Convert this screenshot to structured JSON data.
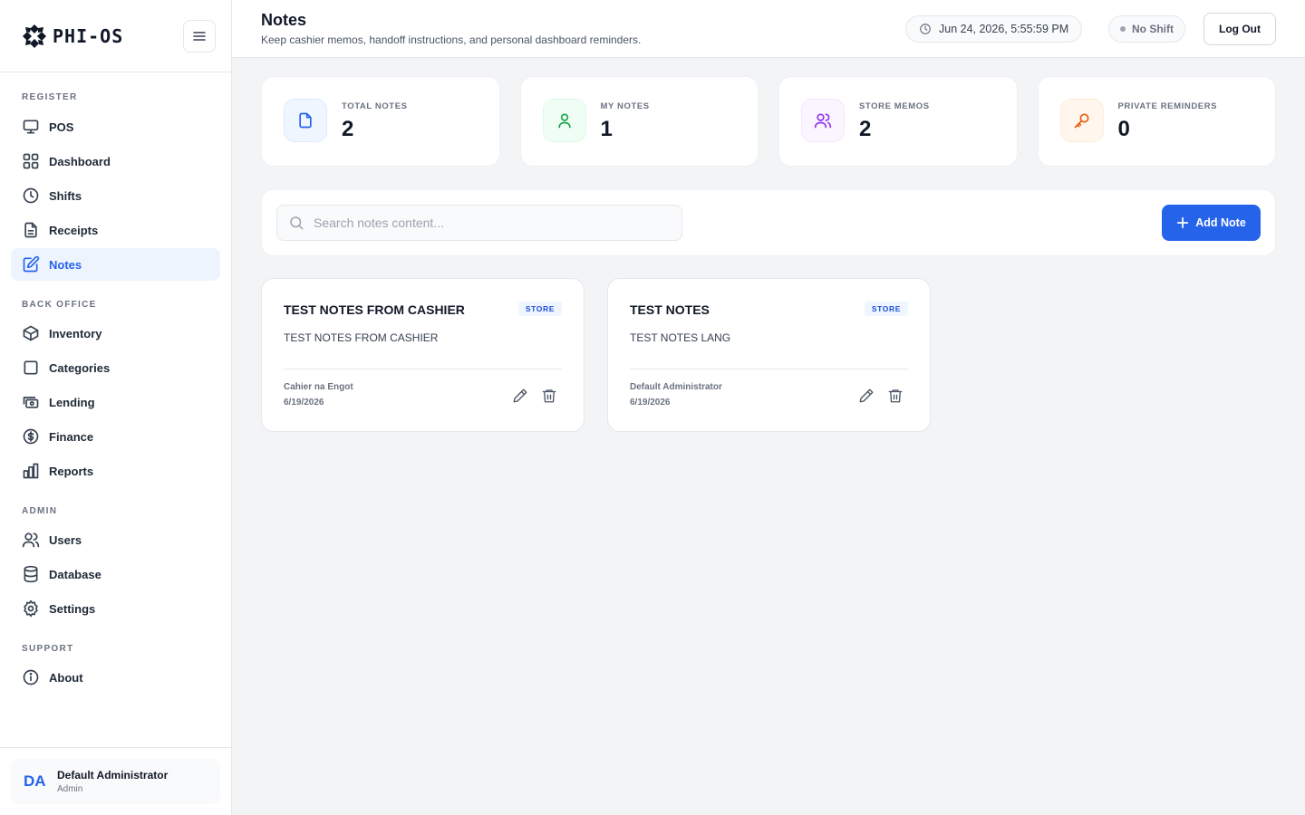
{
  "brand": {
    "name": "PHI-OS"
  },
  "sidebar": {
    "sections": [
      {
        "label": "REGISTER",
        "items": [
          {
            "label": "POS",
            "icon": "monitor-icon"
          },
          {
            "label": "Dashboard",
            "icon": "grid-icon"
          },
          {
            "label": "Shifts",
            "icon": "clock-icon"
          },
          {
            "label": "Receipts",
            "icon": "file-icon"
          },
          {
            "label": "Notes",
            "icon": "edit-icon",
            "active": true
          }
        ]
      },
      {
        "label": "BACK OFFICE",
        "items": [
          {
            "label": "Inventory",
            "icon": "box-icon"
          },
          {
            "label": "Categories",
            "icon": "square-icon"
          },
          {
            "label": "Lending",
            "icon": "cash-icon"
          },
          {
            "label": "Finance",
            "icon": "dollar-icon"
          },
          {
            "label": "Reports",
            "icon": "bar-chart-icon"
          }
        ]
      },
      {
        "label": "ADMIN",
        "items": [
          {
            "label": "Users",
            "icon": "users-icon"
          },
          {
            "label": "Database",
            "icon": "database-icon"
          },
          {
            "label": "Settings",
            "icon": "gear-icon"
          }
        ]
      },
      {
        "label": "SUPPORT",
        "items": [
          {
            "label": "About",
            "icon": "info-icon"
          }
        ]
      }
    ],
    "user": {
      "initials": "DA",
      "name": "Default Administrator",
      "role": "Admin"
    }
  },
  "header": {
    "title": "Notes",
    "subtitle": "Keep cashier memos, handoff instructions, and personal dashboard reminders.",
    "datetime": "Jun 24, 2026, 5:55:59 PM",
    "shift_status": "No Shift",
    "logout_label": "Log Out"
  },
  "stats": [
    {
      "label": "TOTAL NOTES",
      "value": "2",
      "icon": "file-icon",
      "color": "#2563eb",
      "bg": "#eff6ff"
    },
    {
      "label": "MY NOTES",
      "value": "1",
      "icon": "user-icon",
      "color": "#16a34a",
      "bg": "#f0fdf4"
    },
    {
      "label": "STORE MEMOS",
      "value": "2",
      "icon": "users-icon",
      "color": "#9333ea",
      "bg": "#faf5ff"
    },
    {
      "label": "PRIVATE REMINDERS",
      "value": "0",
      "icon": "key-icon",
      "color": "#ea580c",
      "bg": "#fff7ed"
    }
  ],
  "toolbar": {
    "search_placeholder": "Search notes content...",
    "search_value": "",
    "add_label": "Add Note"
  },
  "notes": [
    {
      "title": "TEST NOTES FROM CASHIER",
      "badge": "STORE",
      "content": "TEST NOTES FROM CASHIER",
      "author": "Cahier na Engot",
      "date": "6/19/2026"
    },
    {
      "title": "TEST NOTES",
      "badge": "STORE",
      "content": "TEST NOTES LANG",
      "author": "Default Administrator",
      "date": "6/19/2026"
    }
  ]
}
